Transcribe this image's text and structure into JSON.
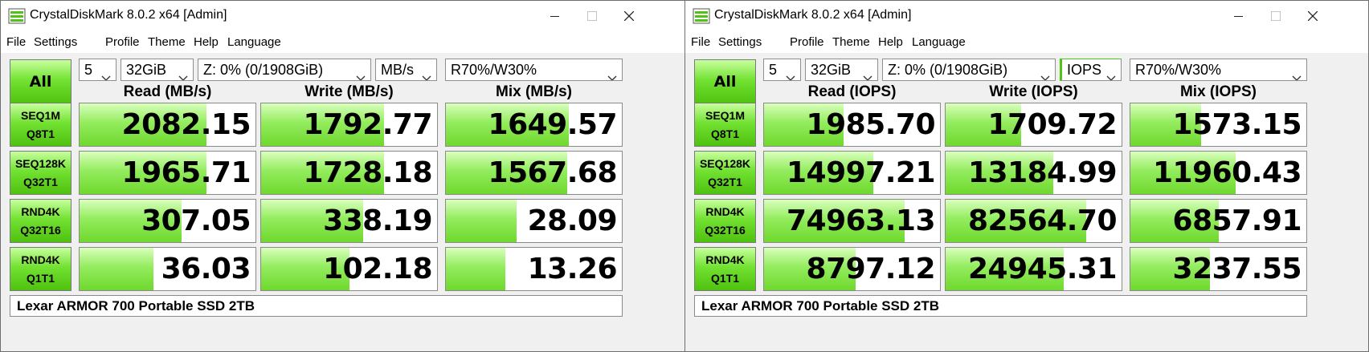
{
  "windows": [
    {
      "title": "CrystalDiskMark 8.0.2 x64 [Admin]",
      "menu": [
        "File",
        "Settings",
        "Profile",
        "Theme",
        "Help",
        "Language"
      ],
      "all_button": "All",
      "count": "5",
      "size": "32GiB",
      "drive": "Z: 0% (0/1908GiB)",
      "unit": "MB/s",
      "mix_ratio": "R70%/W30%",
      "headers": [
        "Read (MB/s)",
        "Write (MB/s)",
        "Mix (MB/s)"
      ],
      "rows": [
        {
          "line1": "SEQ1M",
          "line2": "Q8T1",
          "values": [
            "2082.15",
            "1792.77",
            "1649.57"
          ],
          "fill": [
            0.72,
            0.7,
            0.7
          ]
        },
        {
          "line1": "SEQ128K",
          "line2": "Q32T1",
          "values": [
            "1965.71",
            "1728.18",
            "1567.68"
          ],
          "fill": [
            0.72,
            0.7,
            0.69
          ]
        },
        {
          "line1": "RND4K",
          "line2": "Q32T16",
          "values": [
            "307.05",
            "338.19",
            "28.09"
          ],
          "fill": [
            0.58,
            0.58,
            0.4
          ]
        },
        {
          "line1": "RND4K",
          "line2": "Q1T1",
          "values": [
            "36.03",
            "102.18",
            "13.26"
          ],
          "fill": [
            0.42,
            0.5,
            0.34
          ]
        }
      ],
      "comment": "Lexar ARMOR 700 Portable SSD 2TB"
    },
    {
      "title": "CrystalDiskMark 8.0.2 x64 [Admin]",
      "menu": [
        "File",
        "Settings",
        "Profile",
        "Theme",
        "Help",
        "Language"
      ],
      "all_button": "All",
      "count": "5",
      "size": "32GiB",
      "drive": "Z: 0% (0/1908GiB)",
      "unit": "IOPS",
      "mix_ratio": "R70%/W30%",
      "headers": [
        "Read (IOPS)",
        "Write (IOPS)",
        "Mix (IOPS)"
      ],
      "rows": [
        {
          "line1": "SEQ1M",
          "line2": "Q8T1",
          "values": [
            "1985.70",
            "1709.72",
            "1573.15"
          ],
          "fill": [
            0.45,
            0.43,
            0.4
          ]
        },
        {
          "line1": "SEQ128K",
          "line2": "Q32T1",
          "values": [
            "14997.21",
            "13184.99",
            "11960.43"
          ],
          "fill": [
            0.62,
            0.61,
            0.6
          ]
        },
        {
          "line1": "RND4K",
          "line2": "Q32T16",
          "values": [
            "74963.13",
            "82564.70",
            "6857.91"
          ],
          "fill": [
            0.8,
            0.8,
            0.5
          ]
        },
        {
          "line1": "RND4K",
          "line2": "Q1T1",
          "values": [
            "8797.12",
            "24945.31",
            "3237.55"
          ],
          "fill": [
            0.52,
            0.67,
            0.45
          ]
        }
      ],
      "comment": "Lexar ARMOR 700 Portable SSD 2TB"
    }
  ],
  "colors": {
    "accent_green": "#4ec414",
    "fill_green": "#93ec5e",
    "border": "#8a8a8a"
  },
  "icons": {
    "app": "crystaldiskmark-icon",
    "minimize": "minimize-icon",
    "maximize": "maximize-icon",
    "close": "close-icon",
    "dropdown": "chevron-down-icon"
  }
}
